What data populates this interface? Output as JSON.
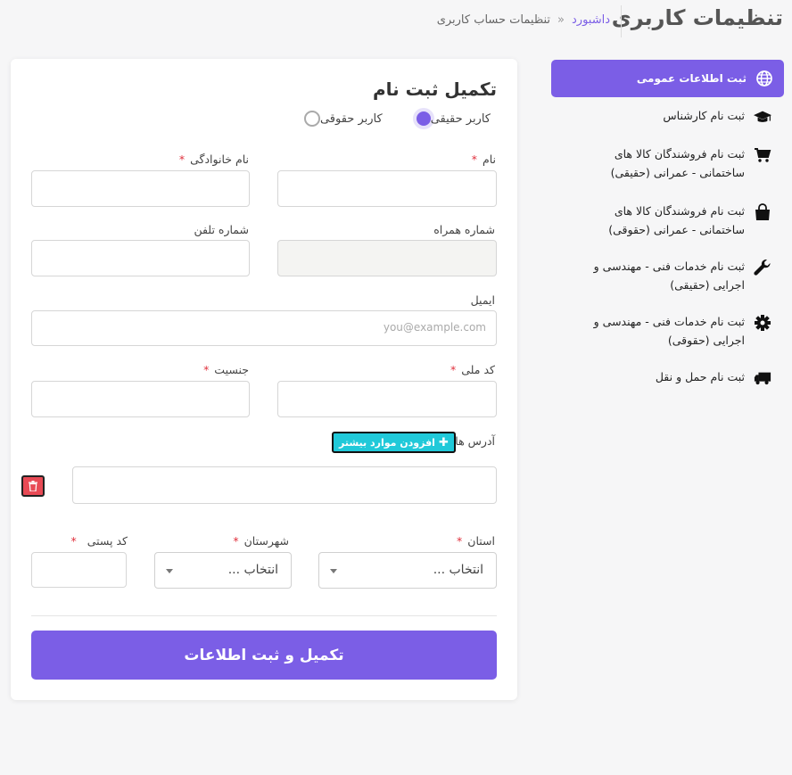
{
  "header": {
    "title": "تنظیمات کاربری",
    "breadcrumb_home": "داشبورد",
    "breadcrumb_sep": "«",
    "breadcrumb_current": "تنظیمات حساب کاربری"
  },
  "sidebar": {
    "items": [
      {
        "label": "ثبت اطلاعات عمومی",
        "icon": "globe-icon",
        "active": true
      },
      {
        "label": "ثبت نام کارشناس",
        "icon": "graduation-cap-icon"
      },
      {
        "label_line1": "ثبت نام فروشندگان کالا های",
        "label_line2": "ساختمانی - عمرانی (حقیقی)",
        "icon": "cart-icon"
      },
      {
        "label_line1": "ثبت نام فروشندگان کالا های",
        "label_line2": "ساختمانی - عمرانی (حقوقی)",
        "icon": "shopping-bag-icon"
      },
      {
        "label_line1": "ثبت نام خدمات فنی - مهندسی و",
        "label_line2": "اجرایی (حقیقی)",
        "icon": "wrench-icon"
      },
      {
        "label_line1": "ثبت نام خدمات فنی - مهندسی و",
        "label_line2": "اجرایی (حقوقی)",
        "icon": "gear-icon"
      },
      {
        "label": "ثبت نام حمل و نقل",
        "icon": "truck-icon"
      }
    ]
  },
  "form": {
    "title": "تکمیل ثبت نام",
    "radio_real": "کاربر حقیقی",
    "radio_legal": "کاربر حقوقی",
    "selected_type": "real",
    "first_name_label": "نام",
    "last_name_label": "نام خانوادگی",
    "mobile_label": "شماره همراه",
    "phone_label": "شماره تلفن",
    "email_label": "ایمیل",
    "email_placeholder": "you@example.com",
    "national_code_label": "کد ملی",
    "gender_label": "جنسیت",
    "addresses_label": "آدرس ها",
    "add_more_label": "افزودن موارد بیشتر",
    "province_label": "استان",
    "province_value": "انتخاب ...",
    "city_label": "شهرستان",
    "city_value": "انتخاب ...",
    "postal_code_label": "کد پستی",
    "required_mark": "*",
    "submit_label": "تکمیل و ثبت اطلاعات"
  },
  "colors": {
    "accent": "#7b5ee6",
    "danger": "#e84a55",
    "info": "#20c9d9",
    "required": "#e0313d"
  }
}
